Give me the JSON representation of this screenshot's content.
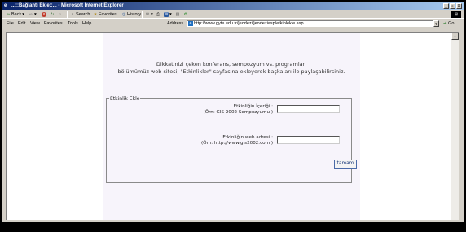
{
  "window": {
    "title": "...::Bağlantı Ekle::... - Microsoft Internet Explorer",
    "controls": [
      "_",
      "▫",
      "×"
    ]
  },
  "toolbar": {
    "back": "Back",
    "search": "Search",
    "favorites": "Favorites",
    "history": "History"
  },
  "menu": {
    "items": [
      "File",
      "Edit",
      "View",
      "Favorites",
      "Tools",
      "Help"
    ],
    "address_label": "Address",
    "address_value": "http://www.gyte.edu.tr/jeodezi/jeodeziasp/etkinlekle.asp",
    "go_label": "Go"
  },
  "page": {
    "intro_line1": "Dikkatinizi çeken konferans, sempozyum vs. programları",
    "intro_line2": "bölümümüz web sitesi, \"Etkinlikler\" sayfasına ekleyerek başkaları ile paylaşabilirsiniz.",
    "fieldset_legend": "Etkinlik Ekle",
    "field1_label": "Etkinliğin İçeriği :",
    "field1_hint": "(Örn: GIS 2002 Sempozyumu )",
    "field1_value": "",
    "field2_label": "Etkinliğin web adresi :",
    "field2_hint": "(Örn: http://www.gis2002.com )",
    "field2_value": "",
    "submit_label": "tamam"
  },
  "colors": {
    "titlebar_start": "#0a246a",
    "titlebar_end": "#a6caf0",
    "chrome": "#d4d0c8",
    "panel": "#f7f4fb"
  }
}
